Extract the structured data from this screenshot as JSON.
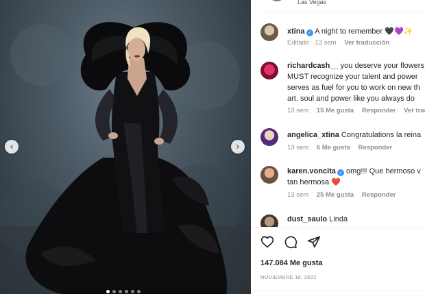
{
  "post": {
    "location": "Las Vegas",
    "author": "xtina",
    "caption": "A night to remember 🖤💜✨",
    "caption_meta": {
      "edited": "Editado",
      "time": "13 sem",
      "translate": "Ver traducción"
    },
    "likes": "147.084 Me gusta",
    "date": "NOVIEMBRE 18, 2022"
  },
  "comments": [
    {
      "user": "richardcash__",
      "lines": [
        "you deserve your flowers",
        "MUST recognize your talent and power",
        "serves as fuel for you to work on new th",
        "art, soul and power like you always do"
      ],
      "time": "13 sem",
      "likes": "15 Me gusta",
      "reply": "Responder",
      "extra": "Ver trad"
    },
    {
      "user": "angelica_xtina",
      "lines": [
        "Congratulations la reina"
      ],
      "time": "13 sem",
      "likes": "6 Me gusta",
      "reply": "Responder"
    },
    {
      "user": "karen.voncita",
      "lines": [
        "omg!!! Que hermoso v",
        "tan hermosa ❤️"
      ],
      "time": "13 sem",
      "likes": "25 Me gusta",
      "reply": "Responder"
    },
    {
      "user": "dust_saulo",
      "lines": [
        "Linda"
      ]
    }
  ],
  "icons": [
    "heart-icon",
    "comment-icon",
    "share-icon",
    "chevron-left-icon",
    "chevron-right-icon",
    "verified-badge-icon"
  ],
  "colors": {
    "verified": "#3897f0",
    "meta": "#8e8e8e",
    "text": "#262626"
  }
}
